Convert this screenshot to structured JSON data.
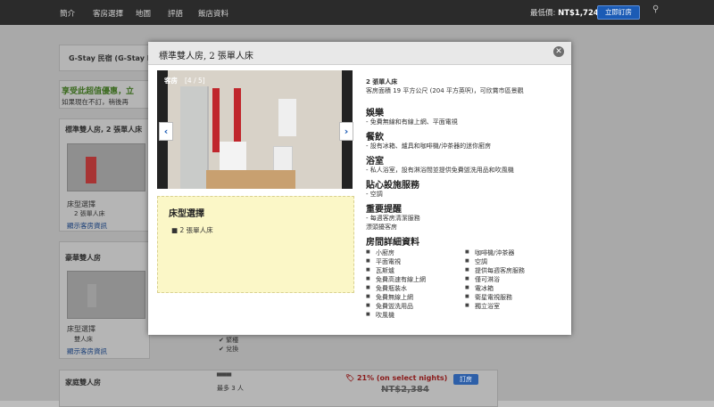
{
  "nav": {
    "items": [
      "簡介",
      "客房選擇",
      "地圖",
      "評語",
      "飯店資料"
    ],
    "price_label": "最低價:",
    "price_value": "NT$1,724",
    "book_button": "立即訂房"
  },
  "background": {
    "hotel_name": "G-Stay 民宿 (G-Stay R",
    "promo_title": "享受此超值優惠，立",
    "promo_sub": "如果現在不訂，稍後再",
    "rooms": [
      {
        "name": "標準雙人房, 2 張單人床",
        "bed_label": "床型選擇",
        "bed_value": "2 張單人床",
        "link": "顯示客房資訊"
      },
      {
        "name": "豪華雙人房",
        "bed_label": "床型選擇",
        "bed_value": "雙人床",
        "link": "顯示客房資訊",
        "feature1": "緊種",
        "feature2": "兌換"
      },
      {
        "name": "家庭雙人房",
        "occupancy": "最多 3 人",
        "discount": "21% (on select nights)",
        "old_price": "NT$2,384",
        "button": "訂房"
      }
    ]
  },
  "modal": {
    "title": "標準雙人房, 2 張單人床",
    "photo_label": "客房",
    "photo_counter": "[4 / 5]",
    "bed_section": {
      "heading": "床型選擇",
      "items": [
        "2 張單人床"
      ]
    },
    "summary_title": "2 張單人床",
    "summary_desc": "客房面積 19 平方公尺 (204 平方英呎)，可欣賞市區景觀",
    "sections": [
      {
        "heading": "娛樂",
        "text": "- 免費無線和有線上網、平面電視"
      },
      {
        "heading": "餐飲",
        "text": "- 設有冰箱、爐具和咖啡機/沖茶器的迷你廚房"
      },
      {
        "heading": "浴室",
        "text": "- 私人浴室，設有淋浴間並提供免費盥洗用品和吹風機"
      },
      {
        "heading": "貼心設施服務",
        "text": "- 空調"
      },
      {
        "heading": "重要提醒",
        "text": "- 每週客房清潔服務",
        "text2": "漂頭擾客房"
      }
    ],
    "amenities_heading": "房間詳細資料",
    "amenities_left": [
      "小廚房",
      "平面電視",
      "瓦斯爐",
      "免費高速有線上網",
      "免費瓶裝水",
      "免費無線上網",
      "免費盥洗用品",
      "吹風機"
    ],
    "amenities_right": [
      "咖啡機/沖茶器",
      "空調",
      "提供每週客房服務",
      "僅可淋浴",
      "電冰箱",
      "衛星電視服務",
      "獨立浴室"
    ]
  }
}
